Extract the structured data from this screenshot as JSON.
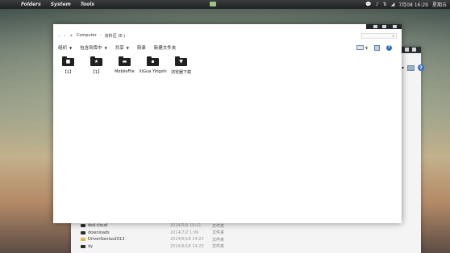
{
  "topbar": {
    "menus": [
      "Folders",
      "System",
      "Tools"
    ],
    "clock": "7月08 16:29",
    "user": "星期五"
  },
  "window": {
    "address": {
      "crumbs": [
        "Computer",
        "资料区 (E:)"
      ],
      "separator": "›"
    },
    "toolbar": {
      "organize": "组织",
      "include_in_library": "包含到库中",
      "share": "共享",
      "burn": "刻录",
      "new_folder": "新建文件夹"
    },
    "items": [
      {
        "label": "【1】",
        "glyph": "■"
      },
      {
        "label": "【1】",
        "glyph": "★"
      },
      {
        "label": "MobileFile",
        "glyph": "▬"
      },
      {
        "label": "XiGua Yingshi",
        "glyph": "▪"
      },
      {
        "label": "浏览器下载",
        "glyph": "▼"
      }
    ]
  },
  "back_window": {
    "rows": [
      {
        "name": "dsd.cloud",
        "date": "2014/5/6 10:11",
        "type": "文件夹",
        "icon": "dark"
      },
      {
        "name": "downloads",
        "date": "2014/7/2 1:06",
        "type": "文件夹",
        "icon": "dark"
      },
      {
        "name": "DriverGenius2013",
        "date": "2014/6/18 14:22",
        "type": "文件夹",
        "icon": "yellow"
      },
      {
        "name": "dy",
        "date": "2014/6/18 14:23",
        "type": "文件夹",
        "icon": "dark"
      }
    ]
  },
  "colors": {
    "panel": "#1f2223",
    "window_bg": "#ffffff",
    "folder_icon": "#202020",
    "help_blue": "#2f6cc4"
  }
}
